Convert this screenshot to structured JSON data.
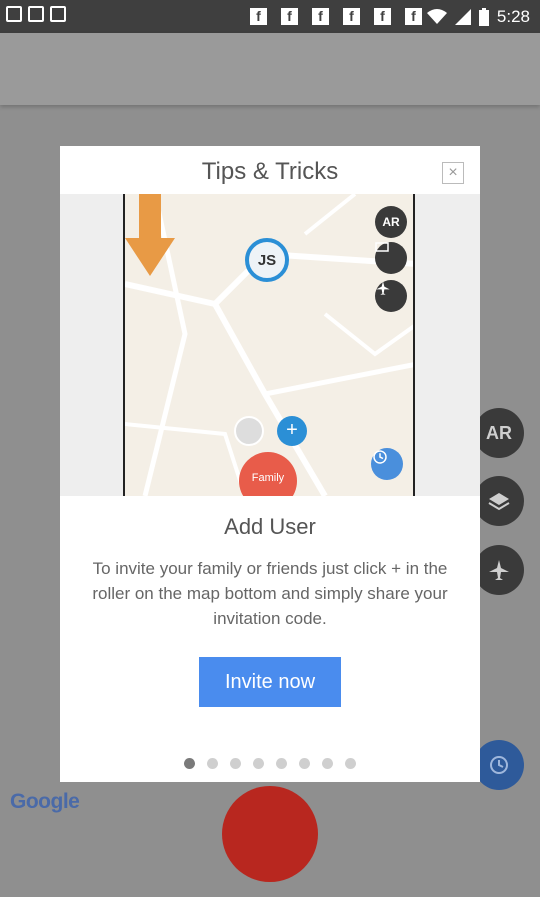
{
  "status_bar": {
    "time": "5:28",
    "notification_glyph": "f"
  },
  "modal": {
    "title": "Tips & Tricks",
    "close_icon": "×",
    "illustration": {
      "pin_initials": "JS",
      "ar_label": "AR",
      "family_label": "Family",
      "plus_label": "+"
    },
    "subtitle": "Add User",
    "body": "To invite your family or friends just click + in the roller on the map bottom and simply share your invitation code.",
    "invite_button": "Invite now",
    "page_indicator": {
      "total": 8,
      "current": 1
    }
  },
  "background": {
    "ar_label": "AR",
    "google_logo": "Google"
  }
}
